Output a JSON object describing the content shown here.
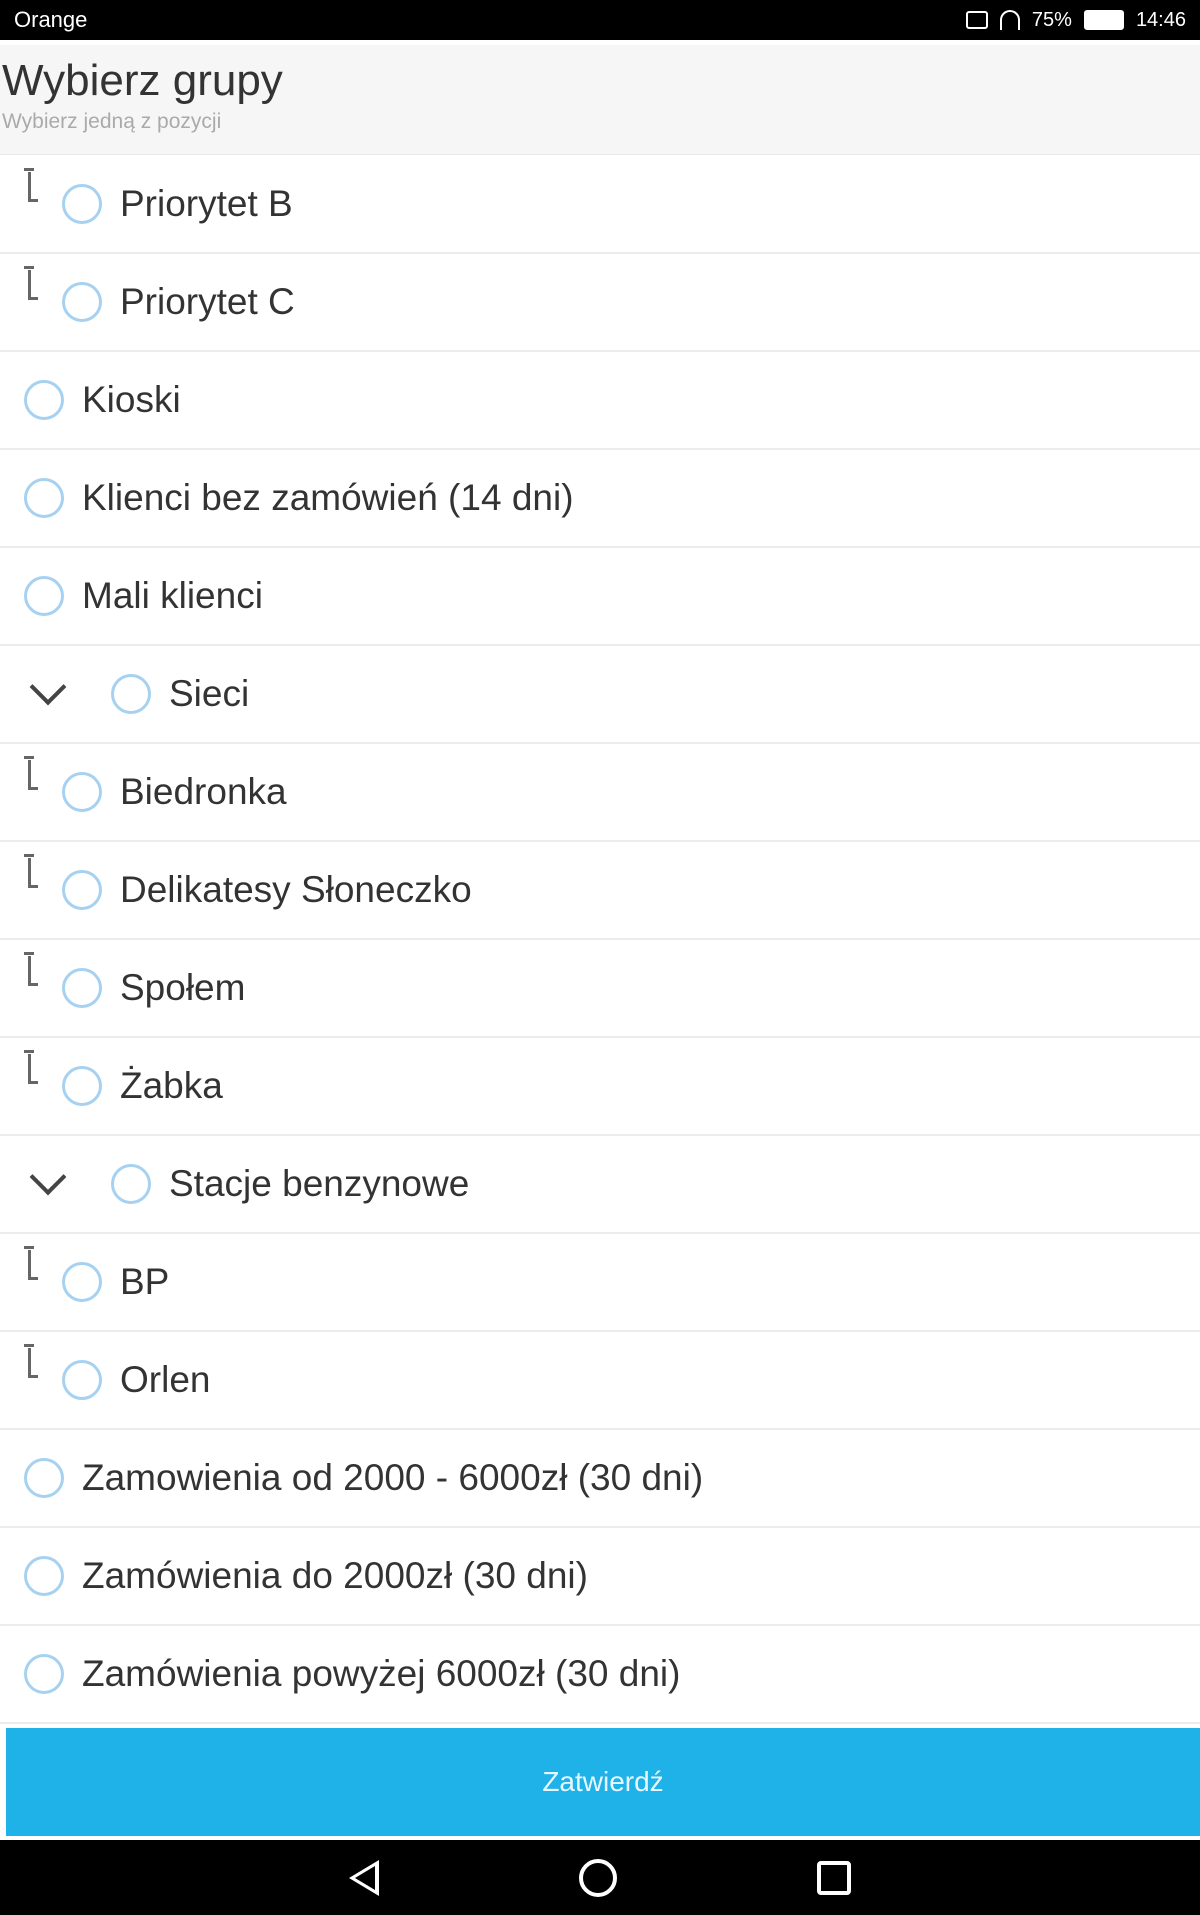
{
  "status_bar": {
    "carrier": "Orange",
    "signal_text": "75%",
    "time": "14:46"
  },
  "header": {
    "title": "Wybierz grupy",
    "subtitle": "Wybierz jedną z pozycji"
  },
  "groups": [
    {
      "label": "Priorytet B",
      "level": "child"
    },
    {
      "label": "Priorytet C",
      "level": "child"
    },
    {
      "label": "Kioski",
      "level": "top"
    },
    {
      "label": "Klienci bez zamówień (14 dni)",
      "level": "top"
    },
    {
      "label": "Mali klienci",
      "level": "top"
    },
    {
      "label": "Sieci",
      "level": "parent"
    },
    {
      "label": "Biedronka",
      "level": "child"
    },
    {
      "label": "Delikatesy Słoneczko",
      "level": "child"
    },
    {
      "label": "Społem",
      "level": "child"
    },
    {
      "label": "Żabka",
      "level": "child"
    },
    {
      "label": "Stacje benzynowe",
      "level": "parent"
    },
    {
      "label": "BP",
      "level": "child"
    },
    {
      "label": "Orlen",
      "level": "child"
    },
    {
      "label": "Zamowienia od 2000 - 6000zł (30 dni)",
      "level": "top"
    },
    {
      "label": "Zamówienia do 2000zł (30 dni)",
      "level": "top"
    },
    {
      "label": "Zamówienia powyżej 6000zł (30 dni)",
      "level": "top"
    }
  ],
  "submit_label": "Zatwierdź",
  "icons": {
    "radio": "radio-unchecked-icon",
    "chevron": "chevron-down-icon",
    "child": "tree-child-connector-icon",
    "back": "back-triangle-icon",
    "home": "home-circle-icon",
    "recent": "recent-apps-square-icon"
  },
  "colors": {
    "accent": "#1eb2e8",
    "radio_border": "#a6d1f0",
    "header_bg": "#f6f6f6"
  }
}
